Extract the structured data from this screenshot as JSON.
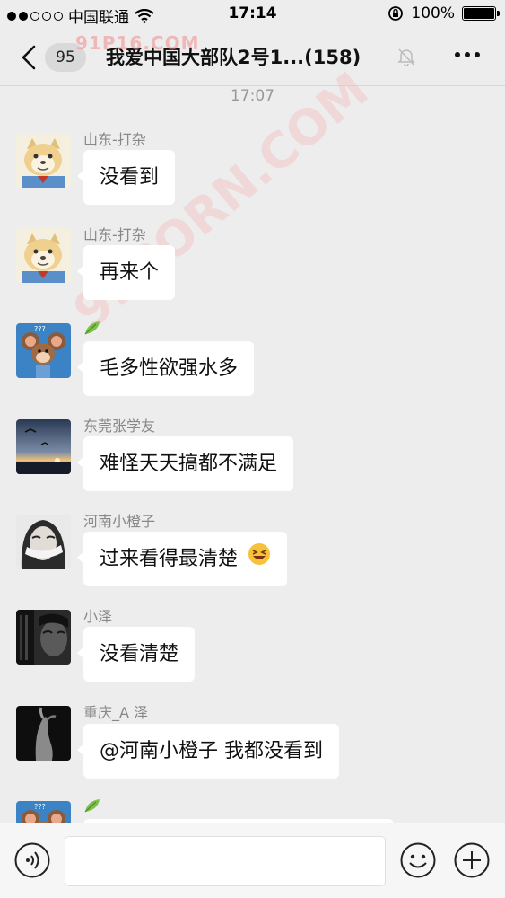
{
  "status_bar": {
    "carrier": "中国联通",
    "time": "17:14",
    "battery": "100%",
    "signal_dots": 5,
    "signal_filled": 2
  },
  "nav": {
    "unread_badge": "95",
    "title": "我爱中国大部队2号1...(158)",
    "icons": [
      "back-chevron-icon",
      "mute-bell-icon",
      "more-options-icon"
    ]
  },
  "watermark": {
    "top_text": "91P16.COM",
    "diagonal_text": "91PORN.COM"
  },
  "chat": {
    "timestamp": "17:07",
    "messages": [
      {
        "sender": "山东-打杂",
        "text": "没看到",
        "avatar": "cartoon-dog-avatar"
      },
      {
        "sender": "山东-打杂",
        "text": "再来个",
        "avatar": "cartoon-dog-avatar"
      },
      {
        "sender": "",
        "text": "毛多性欲强水多",
        "avatar": "cartoon-mouse-avatar",
        "name_icon": "leaf-icon"
      },
      {
        "sender": "东莞张学友",
        "text": "难怪天天搞都不满足",
        "avatar": "sunset-avatar"
      },
      {
        "sender": "河南小橙子",
        "text": "过来看得最清楚",
        "avatar": "girl-photo-avatar",
        "emoji": "😆"
      },
      {
        "sender": "小泽",
        "text": "没看清楚",
        "avatar": "dark-photo-avatar"
      },
      {
        "sender": "重庆_A 泽",
        "text": "@河南小橙子 我都没看到",
        "avatar": "hand-photo-avatar"
      },
      {
        "sender": "",
        "text": "",
        "avatar": "cartoon-mouse-avatar",
        "name_icon": "leaf-icon"
      }
    ]
  },
  "input_bar": {
    "icons": [
      "voice-input-icon",
      "emoji-icon",
      "add-icon"
    ],
    "text_value": ""
  },
  "colors": {
    "background": "#ededed",
    "bubble": "#ffffff",
    "sender_text": "#888888",
    "watermark": "#f08c8c"
  }
}
